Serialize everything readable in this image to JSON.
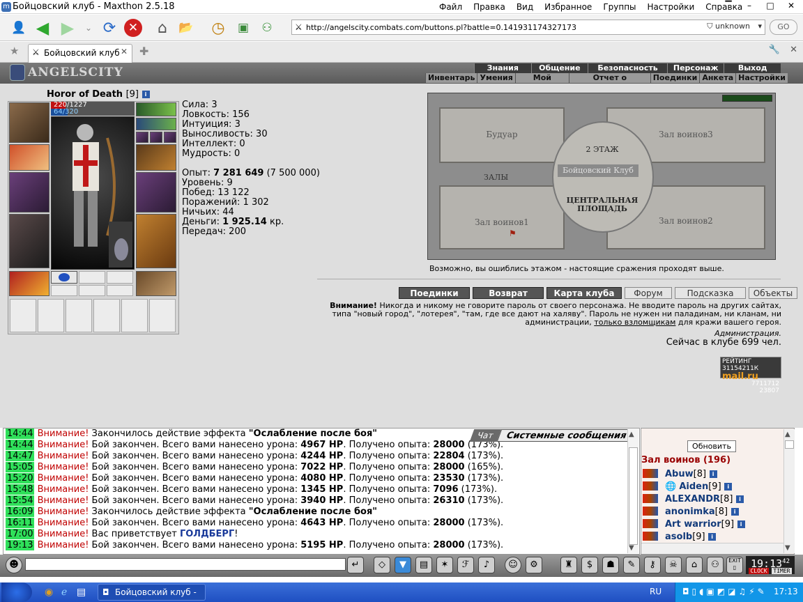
{
  "window": {
    "title": "Бойцовский клуб - Maxthon 2.5.18"
  },
  "menu": [
    "Файл",
    "Правка",
    "Вид",
    "Избранное",
    "Группы",
    "Настройки",
    "Справка"
  ],
  "address": {
    "url": "http://angelscity.combats.com/buttons.pl?battle=0.141931174327173",
    "security": "unknown",
    "go": "GO"
  },
  "tab": {
    "label": "Бойцовский клуб"
  },
  "site": {
    "logo": "ANGELSCITY",
    "nav_top": [
      "Знания",
      "Общение",
      "Безопасность",
      "Персонаж",
      "Выход"
    ],
    "nav_bottom": [
      "Инвентарь",
      "Умения",
      "Мой Скролл",
      "Отчет о переводах",
      "Поединки",
      "Анкета",
      "Настройки"
    ]
  },
  "character": {
    "name": "Horor of Death",
    "level": "[9]",
    "hp": "220/1227",
    "hp_fraction": 0.179,
    "mp": "64/320",
    "mp_fraction": 0.2
  },
  "stats": {
    "strength": "Сила: 3",
    "agility": "Ловкость: 156",
    "intuition": "Интуиция: 3",
    "endurance": "Выносливость: 30",
    "intellect": "Интеллект: 0",
    "wisdom": "Мудрость: 0",
    "exp_label": "Опыт: ",
    "exp_value": "7 281 649",
    "exp_next": " (7 500 000)",
    "level": "Уровень: 9",
    "wins": "Побед: 13 122",
    "losses": "Поражений: 1 302",
    "draws": "Ничьих: 44",
    "money_label": "Деньги: ",
    "money_value": "1 925.14",
    "money_unit": " кр.",
    "transfers": "Передач: 200"
  },
  "map": {
    "boudoir": "Будуар",
    "hall3": "Зал воинов3",
    "floor2": "2 ЭТАЖ",
    "club": "Бойцовский Клуб",
    "halls": "ЗАЛЫ",
    "central": "ЦЕНТРАЛЬНАЯ ПЛОЩАДЬ",
    "hall1": "Зал воинов1",
    "hall2": "Зал воинов2",
    "note": "Возможно, вы ошиблись этажом - настоящие сражения проходят выше."
  },
  "buttons": [
    "Поединки",
    "Возврат",
    "Карта клуба",
    "Форум",
    "Подсказка",
    "Объекты"
  ],
  "warning": {
    "label": "Внимание!",
    "text": " Никогда и никому не говорите пароль от своего персонажа. Не вводите пароль на других сайтах, типа \"новый город\", \"лотерея\", \"там, где все дают на халяву\". Пароль не нужен ни паладинам, ни кланам, ни администрации, ",
    "link": "только взломщикам",
    "tail": " для кражи вашего героя.",
    "admin": "Администрация."
  },
  "online": "Сейчас в клубе 699 чел.",
  "rating": {
    "title": "РЕЙТИНГ 31154211К",
    "brand": "mail.ru",
    "n1": "7711712",
    "n2": "23807"
  },
  "chat": {
    "tab_chat": "Чат",
    "tab_system": "Системные сообщения",
    "lines": [
      {
        "t": "14:44",
        "w": "Внимание!",
        "a": " Закончилось действие эффекта ",
        "b": "\"Ослабление после боя\"",
        "c": "",
        "d": "",
        "e": "",
        "f": ""
      },
      {
        "t": "14:44",
        "w": "Внимание!",
        "a": " Бой закончен. Всего вами нанесено урона: ",
        "b": "4967 HP",
        "c": ". Получено опыта: ",
        "d": "28000",
        "e": " (173%).",
        "f": ""
      },
      {
        "t": "14:47",
        "w": "Внимание!",
        "a": " Бой закончен. Всего вами нанесено урона: ",
        "b": "4244 HP",
        "c": ". Получено опыта: ",
        "d": "22804",
        "e": " (173%).",
        "f": ""
      },
      {
        "t": "15:05",
        "w": "Внимание!",
        "a": " Бой закончен. Всего вами нанесено урона: ",
        "b": "7022 HP",
        "c": ". Получено опыта: ",
        "d": "28000",
        "e": " (165%).",
        "f": ""
      },
      {
        "t": "15:20",
        "w": "Внимание!",
        "a": " Бой закончен. Всего вами нанесено урона: ",
        "b": "4080 HP",
        "c": ". Получено опыта: ",
        "d": "23530",
        "e": " (173%).",
        "f": ""
      },
      {
        "t": "15:48",
        "w": "Внимание!",
        "a": " Бой закончен. Всего вами нанесено урона: ",
        "b": "1345 HP",
        "c": ". Получено опыта: ",
        "d": "7096",
        "e": " (173%).",
        "f": ""
      },
      {
        "t": "15:54",
        "w": "Внимание!",
        "a": " Бой закончен. Всего вами нанесено урона: ",
        "b": "3940 HP",
        "c": ". Получено опыта: ",
        "d": "26310",
        "e": " (173%).",
        "f": ""
      },
      {
        "t": "16:09",
        "w": "Внимание!",
        "a": " Закончилось действие эффекта ",
        "b": "\"Ослабление после боя\"",
        "c": "",
        "d": "",
        "e": "",
        "f": ""
      },
      {
        "t": "16:11",
        "w": "Внимание!",
        "a": " Бой закончен. Всего вами нанесено урона: ",
        "b": "4643 HP",
        "c": ". Получено опыта: ",
        "d": "28000",
        "e": " (173%).",
        "f": ""
      },
      {
        "t": "17:00",
        "w": "Внимание!",
        "a": " Вас приветствует ",
        "b": "",
        "c": "",
        "d": "",
        "e": "",
        "f": "ГОЛДБЕРГ"
      },
      {
        "t": "19:13",
        "w": "Внимание!",
        "a": " Бой закончен. Всего вами нанесено урона: ",
        "b": "5195 HP",
        "c": ". Получено опыта: ",
        "d": "28000",
        "e": " (173%).",
        "f": ""
      }
    ],
    "greeting_end": "!"
  },
  "panel": {
    "refresh": "Обновить",
    "room": "Зал воинов (196)",
    "users": [
      {
        "name": "Abuw",
        "level": "[8]"
      },
      {
        "name": "Aiden",
        "level": "[9]"
      },
      {
        "name": "ALEXANDR",
        "level": "[8]"
      },
      {
        "name": "anonimka",
        "level": "[8]"
      },
      {
        "name": "Art warrior",
        "level": "[9]"
      },
      {
        "name": "asolb",
        "level": "[9]"
      }
    ]
  },
  "clock": {
    "time": "19:13",
    "seconds": "42",
    "label1": "CLOCK",
    "label2": "TIMER",
    "exit": "EXIT"
  },
  "taskbar": {
    "item": "Бойцовский клуб - M...",
    "lang": "RU",
    "time": "17:13"
  },
  "colors": {
    "hp": "#c01010",
    "mp": "#1a4e9a",
    "timestamp": "#2fe05a",
    "warning": "#c00000",
    "room": "#990000"
  }
}
